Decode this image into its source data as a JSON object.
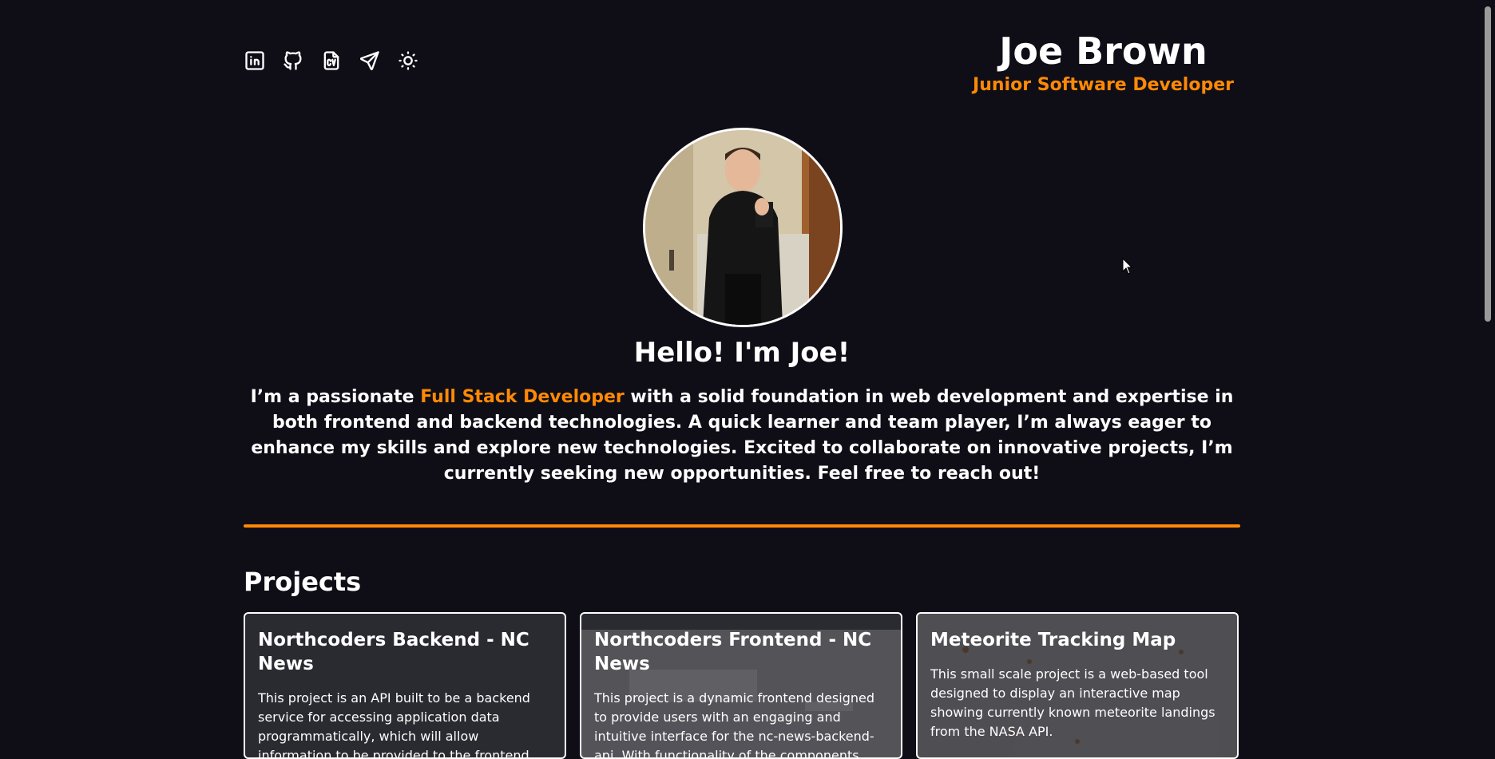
{
  "header": {
    "name": "Joe Brown",
    "role": "Junior Software Developer",
    "icons": [
      "linkedin-icon",
      "github-icon",
      "cv-icon",
      "send-icon",
      "sun-icon"
    ],
    "cv_label": "CV"
  },
  "hero": {
    "greeting": "Hello! I'm Joe!",
    "bio_before": "I’m a passionate ",
    "bio_highlight": "Full Stack Developer",
    "bio_after": " with a solid foundation in web development and expertise in both frontend and backend technologies. A quick learner and team player, I’m always eager to enhance my skills and explore new technologies. Excited to collaborate on innovative projects, I’m currently seeking new opportunities. Feel free to reach out!"
  },
  "projects": {
    "title": "Projects",
    "items": [
      {
        "title": "Northcoders Backend - NC News",
        "description": "This project is an API built to be a backend service for accessing application data programmatically, which will allow information to be provided to the frontend architecture."
      },
      {
        "title": "Northcoders Frontend - NC News",
        "description": "This project is a dynamic frontend designed to provide users with an engaging and intuitive interface for the nc-news-backend-api. With functionality of the components being prioritised"
      },
      {
        "title": "Meteorite Tracking Map",
        "description": "This small scale project is a web-based tool designed to display an interactive map showing currently known meteorite landings from the NASA API."
      }
    ]
  },
  "colors": {
    "background": "#0f0e17",
    "accent": "#ff8906",
    "text": "#ffffff"
  }
}
